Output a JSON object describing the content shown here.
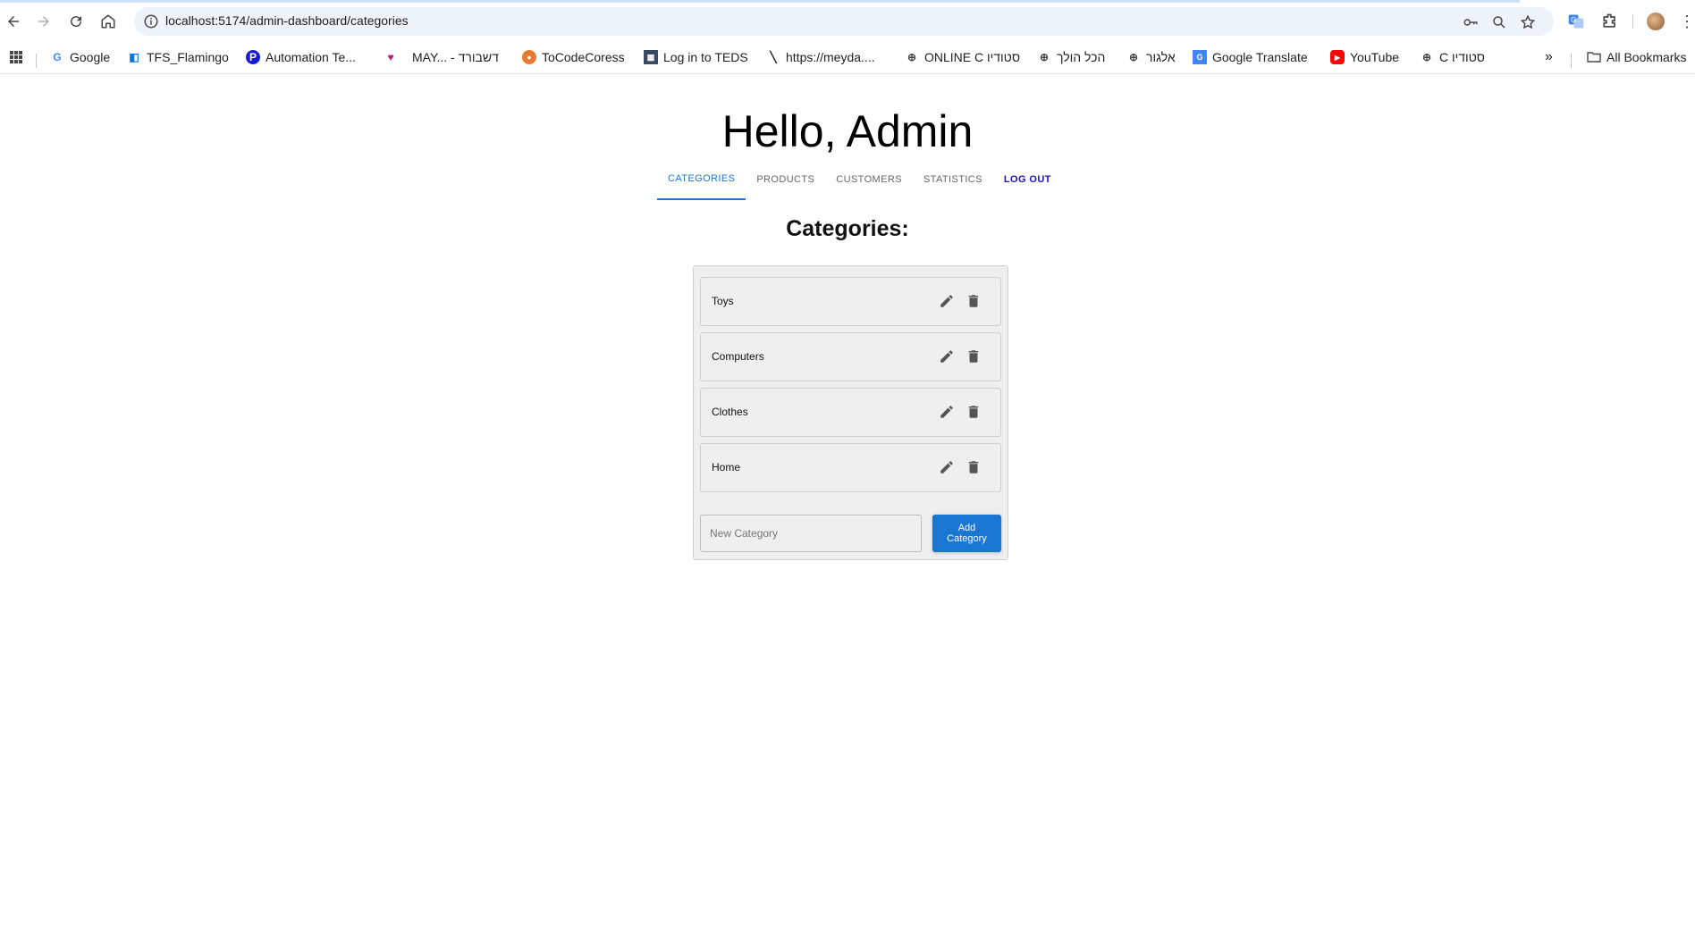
{
  "browser": {
    "url": "localhost:5174/admin-dashboard/categories",
    "bookmarks": [
      {
        "label": "Google",
        "icon": "google-icon",
        "color": "#4285f4"
      },
      {
        "label": "TFS_Flamingo",
        "icon": "azure-devops-icon",
        "color": "#0078d7"
      },
      {
        "label": "Automation Te...",
        "icon": "p-logo-icon",
        "color": "#1a1ad6"
      },
      {
        "label": "MAY... - דשבורד",
        "icon": "heart-icon",
        "color": "#c2187a"
      },
      {
        "label": "ToCodeCoress",
        "icon": "tocode-icon",
        "color": "#e8792f"
      },
      {
        "label": "Log in to TEDS",
        "icon": "teds-icon",
        "color": "#3b4a63"
      },
      {
        "label": "https://meyda....",
        "icon": "slash-icon",
        "color": "#1f1f1f"
      },
      {
        "label": "ONLINE C סטודיו",
        "icon": "globe-icon",
        "color": "#474747"
      },
      {
        "label": "הכל הולך",
        "icon": "globe-icon",
        "color": "#474747"
      },
      {
        "label": "אלגור",
        "icon": "globe-icon",
        "color": "#474747"
      },
      {
        "label": "Google Translate",
        "icon": "translate-icon",
        "color": "#4285f4"
      },
      {
        "label": "YouTube",
        "icon": "youtube-icon",
        "color": "#ff0000"
      },
      {
        "label": "C סטודיו",
        "icon": "globe-icon",
        "color": "#474747"
      }
    ],
    "overflow": "»",
    "all_bookmarks": "All Bookmarks"
  },
  "header": {
    "greeting": "Hello, Admin"
  },
  "tabs": [
    {
      "label": "CATEGORIES",
      "active": true
    },
    {
      "label": "PRODUCTS",
      "active": false
    },
    {
      "label": "CUSTOMERS",
      "active": false
    },
    {
      "label": "STATISTICS",
      "active": false
    },
    {
      "label": "LOG OUT",
      "active": false
    }
  ],
  "categories": {
    "title": "Categories:",
    "items": [
      {
        "name": "Toys"
      },
      {
        "name": "Computers"
      },
      {
        "name": "Clothes"
      },
      {
        "name": "Home"
      }
    ],
    "new_placeholder": "New Category",
    "new_value": "",
    "add_label": "Add Category"
  },
  "colors": {
    "accent": "#1976d2",
    "logout": "#1a14b3"
  }
}
